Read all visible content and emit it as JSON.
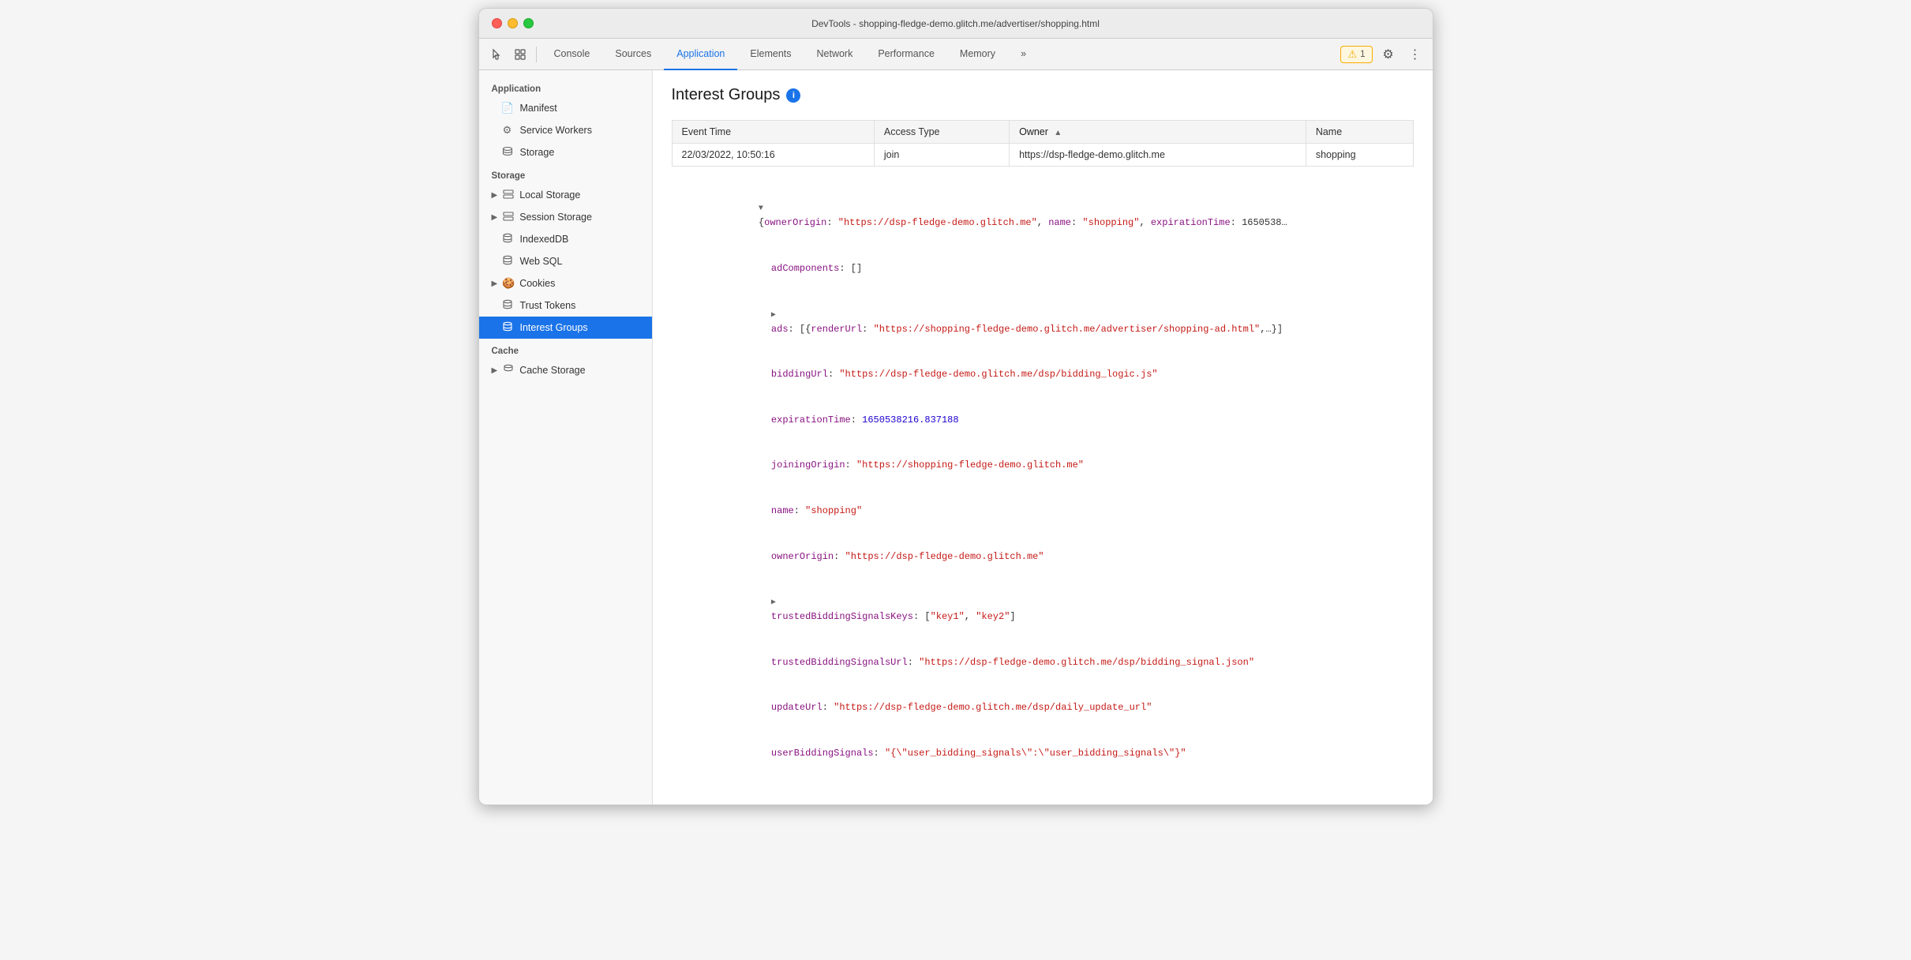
{
  "window": {
    "title": "DevTools - shopping-fledge-demo.glitch.me/advertiser/shopping.html"
  },
  "toolbar": {
    "tabs": [
      {
        "id": "console",
        "label": "Console"
      },
      {
        "id": "sources",
        "label": "Sources"
      },
      {
        "id": "application",
        "label": "Application",
        "active": true
      },
      {
        "id": "elements",
        "label": "Elements"
      },
      {
        "id": "network",
        "label": "Network"
      },
      {
        "id": "performance",
        "label": "Performance"
      },
      {
        "id": "memory",
        "label": "Memory"
      }
    ],
    "more_label": "»",
    "warning_count": "1",
    "settings_icon": "⚙",
    "more_icon": "⋮"
  },
  "sidebar": {
    "sections": [
      {
        "title": "Application",
        "items": [
          {
            "id": "manifest",
            "label": "Manifest",
            "icon": "📄",
            "type": "item"
          },
          {
            "id": "service-workers",
            "label": "Service Workers",
            "icon": "⚙",
            "type": "item"
          },
          {
            "id": "storage",
            "label": "Storage",
            "icon": "🗄",
            "type": "item"
          }
        ]
      },
      {
        "title": "Storage",
        "items": [
          {
            "id": "local-storage",
            "label": "Local Storage",
            "icon": "▦",
            "type": "expandable"
          },
          {
            "id": "session-storage",
            "label": "Session Storage",
            "icon": "▦",
            "type": "expandable"
          },
          {
            "id": "indexed-db",
            "label": "IndexedDB",
            "icon": "🗄",
            "type": "item"
          },
          {
            "id": "web-sql",
            "label": "Web SQL",
            "icon": "🗄",
            "type": "item"
          },
          {
            "id": "cookies",
            "label": "Cookies",
            "icon": "🍪",
            "type": "expandable"
          },
          {
            "id": "trust-tokens",
            "label": "Trust Tokens",
            "icon": "🗄",
            "type": "item"
          },
          {
            "id": "interest-groups",
            "label": "Interest Groups",
            "icon": "🗄",
            "type": "item",
            "active": true
          }
        ]
      },
      {
        "title": "Cache",
        "items": [
          {
            "id": "cache-storage",
            "label": "Cache Storage",
            "icon": "🗄",
            "type": "item"
          }
        ]
      }
    ]
  },
  "interest_groups": {
    "title": "Interest Groups",
    "table": {
      "columns": [
        {
          "id": "event_time",
          "label": "Event Time"
        },
        {
          "id": "access_type",
          "label": "Access Type"
        },
        {
          "id": "owner",
          "label": "Owner",
          "sorted": true,
          "sort_dir": "asc"
        },
        {
          "id": "name",
          "label": "Name"
        }
      ],
      "rows": [
        {
          "event_time": "22/03/2022, 10:50:16",
          "access_type": "join",
          "owner": "https://dsp-fledge-demo.glitch.me",
          "name": "shopping"
        }
      ]
    },
    "json_detail": {
      "lines": [
        {
          "indent": 0,
          "type": "expand-open",
          "text": "▼ {ownerOrigin: \"https://dsp-fledge-demo.glitch.me\", name: \"shopping\", expirationTime: 1650538…"
        },
        {
          "indent": 1,
          "type": "key-value",
          "key": "adComponents",
          "value": "[]",
          "value_type": "punctuation"
        },
        {
          "indent": 1,
          "type": "expand-closed",
          "text": "▶ ads: [{renderUrl: \"https://shopping-fledge-demo.glitch.me/advertiser/shopping-ad.html\",…}]"
        },
        {
          "indent": 1,
          "type": "key-string",
          "key": "biddingUrl",
          "value": "\"https://dsp-fledge-demo.glitch.me/dsp/bidding_logic.js\""
        },
        {
          "indent": 1,
          "type": "key-number",
          "key": "expirationTime",
          "value": "1650538216.837188"
        },
        {
          "indent": 1,
          "type": "key-string",
          "key": "joiningOrigin",
          "value": "\"https://shopping-fledge-demo.glitch.me\""
        },
        {
          "indent": 1,
          "type": "key-string",
          "key": "name",
          "value": "\"shopping\""
        },
        {
          "indent": 1,
          "type": "key-string",
          "key": "ownerOrigin",
          "value": "\"https://dsp-fledge-demo.glitch.me\""
        },
        {
          "indent": 1,
          "type": "expand-closed",
          "text": "▶ trustedBiddingSignalsKeys: [\"key1\", \"key2\"]"
        },
        {
          "indent": 1,
          "type": "key-string",
          "key": "trustedBiddingSignalsUrl",
          "value": "\"https://dsp-fledge-demo.glitch.me/dsp/bidding_signal.json\""
        },
        {
          "indent": 1,
          "type": "key-string",
          "key": "updateUrl",
          "value": "\"https://dsp-fledge-demo.glitch.me/dsp/daily_update_url\""
        },
        {
          "indent": 1,
          "type": "key-string",
          "key": "userBiddingSignals",
          "value": "\"{\\\"user_bidding_signals\\\":\\\"user_bidding_signals\\\"}\""
        }
      ]
    }
  }
}
